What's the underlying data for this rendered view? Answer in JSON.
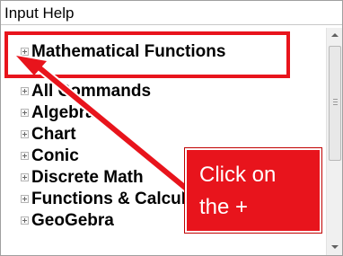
{
  "panel": {
    "title": "Input Help"
  },
  "tree": {
    "items": [
      {
        "label": "Mathematical Functions"
      },
      {
        "label": "All Commands"
      },
      {
        "label": "Algebra"
      },
      {
        "label": "Chart"
      },
      {
        "label": "Conic"
      },
      {
        "label": "Discrete Math"
      },
      {
        "label": "Functions & Calculus"
      },
      {
        "label": "GeoGebra"
      }
    ]
  },
  "annotation": {
    "callout_line1": "Click on",
    "callout_line2": "the +",
    "color": "#e8141c"
  }
}
